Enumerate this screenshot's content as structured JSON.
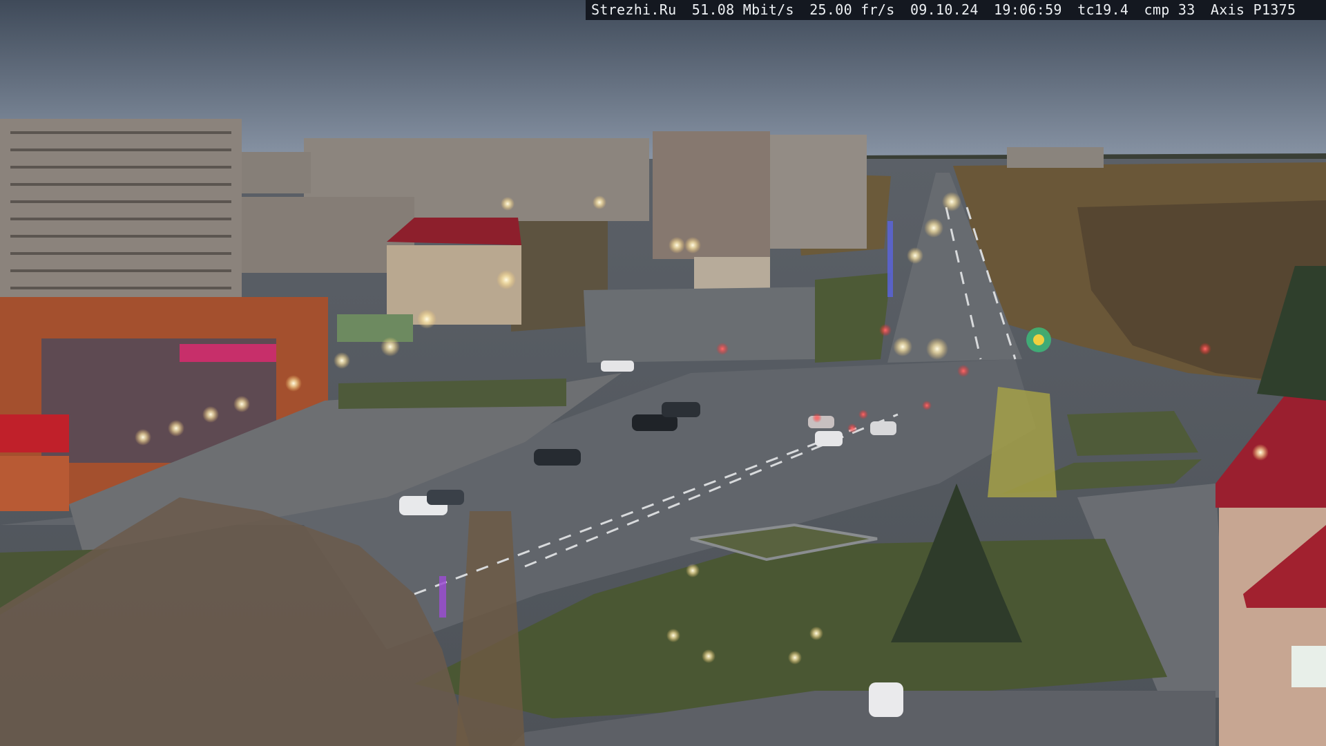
{
  "overlay": {
    "site": "Strezhi.Ru",
    "bitrate": "51.08 Mbit/s",
    "framerate": "25.00 fr/s",
    "date": "09.10.24",
    "time": "19:06:59",
    "tc": "tc19.4",
    "cmp": "cmp 33",
    "camera": "Axis P1375"
  },
  "colors": {
    "sky_top": "#4a5566",
    "sky_horizon": "#8a96a6",
    "road": "#5a5f66",
    "grass": "#4e5a3a",
    "building_brick": "#8a7f78",
    "red_roof": "#9a2030",
    "street_light": "#fff6d8",
    "traffic_red": "#ff2b2b"
  }
}
